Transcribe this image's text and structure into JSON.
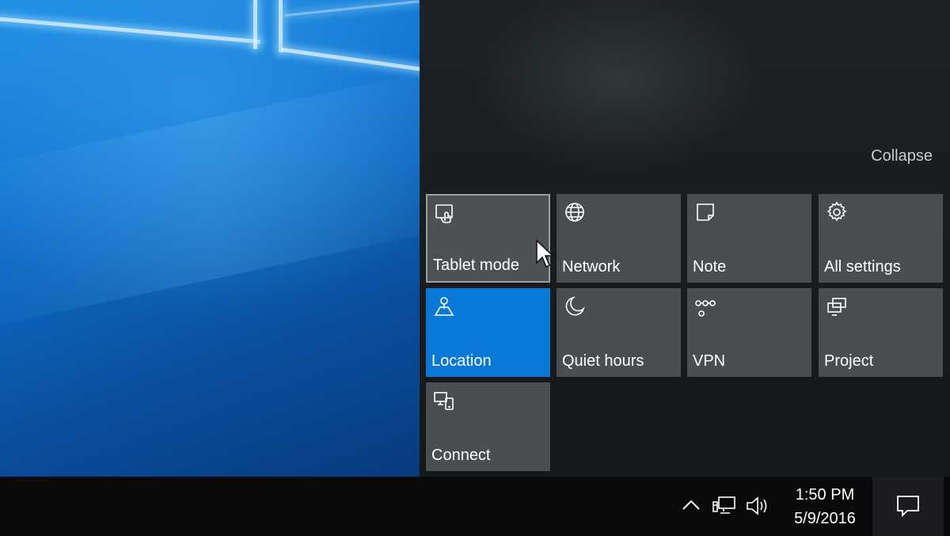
{
  "action_center": {
    "collapse_label": "Collapse",
    "accent_color": "#0a78d7",
    "tiles": [
      {
        "label": "Tablet mode",
        "icon": "tablet-mode-icon",
        "state": "hover"
      },
      {
        "label": "Network",
        "icon": "globe-icon",
        "state": "off"
      },
      {
        "label": "Note",
        "icon": "note-icon",
        "state": "off"
      },
      {
        "label": "All settings",
        "icon": "gear-icon",
        "state": "off"
      },
      {
        "label": "Location",
        "icon": "location-icon",
        "state": "on"
      },
      {
        "label": "Quiet hours",
        "icon": "moon-icon",
        "state": "off"
      },
      {
        "label": "VPN",
        "icon": "vpn-icon",
        "state": "off"
      },
      {
        "label": "Project",
        "icon": "project-icon",
        "state": "off"
      },
      {
        "label": "Connect",
        "icon": "connect-icon",
        "state": "off"
      }
    ]
  },
  "taskbar": {
    "tray_icons": [
      "chevron-up-icon",
      "network-icon",
      "volume-icon"
    ],
    "clock": {
      "time": "1:50 PM",
      "date": "5/9/2016"
    },
    "notification_icon": "action-center-icon"
  }
}
